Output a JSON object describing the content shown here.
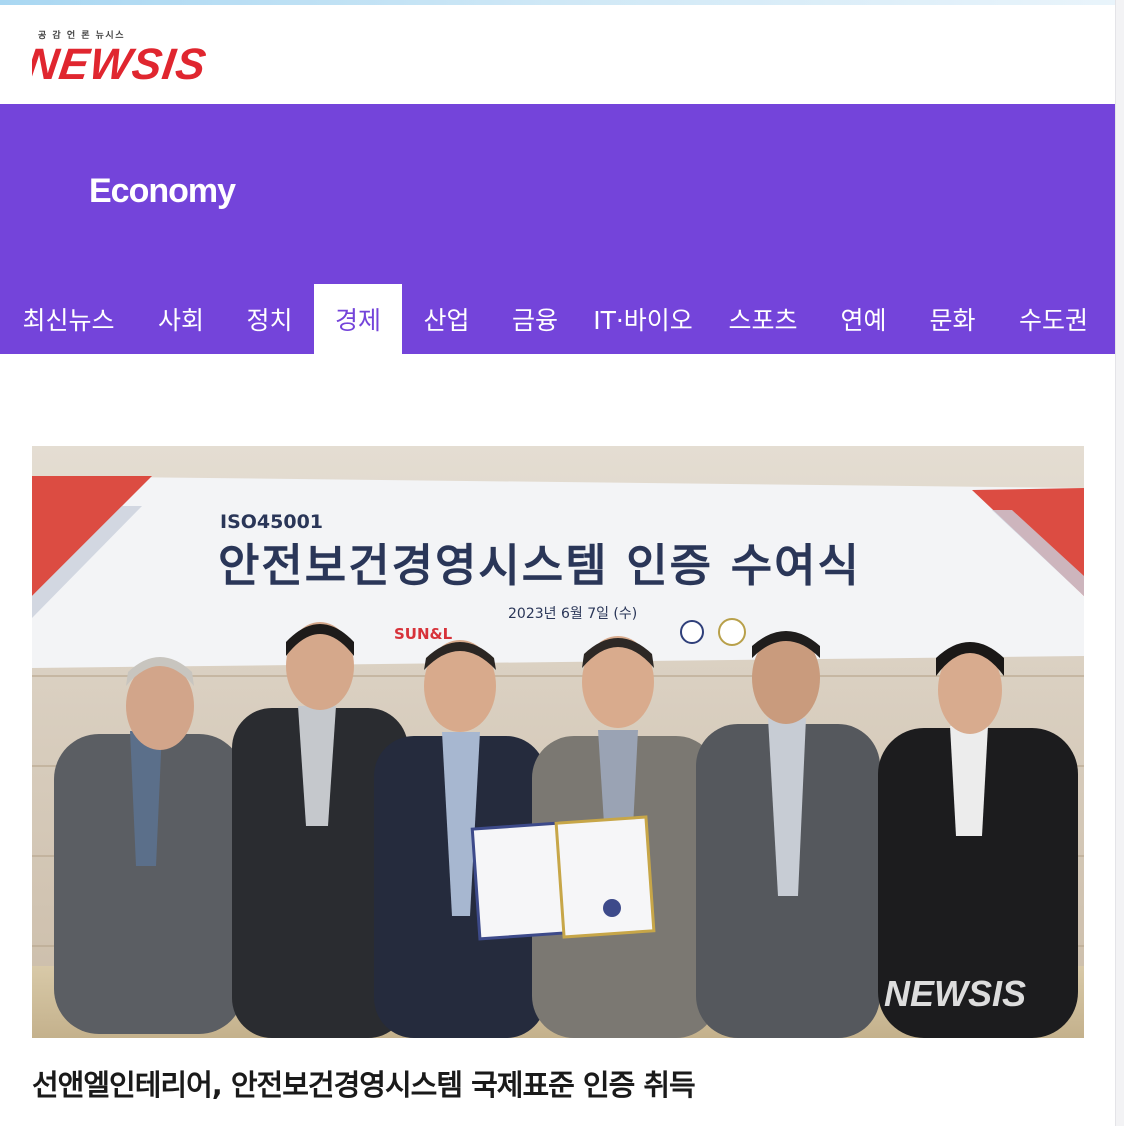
{
  "brand": {
    "logo_text": "NEWSIS",
    "logo_tagline": "공 감 언 론 뉴시스",
    "accent_color": "#7444da",
    "logo_color": "#e0262f"
  },
  "section": {
    "title": "Economy"
  },
  "nav": {
    "items": [
      {
        "label": "최신뉴스",
        "active": false
      },
      {
        "label": "사회",
        "active": false
      },
      {
        "label": "정치",
        "active": false
      },
      {
        "label": "경제",
        "active": true
      },
      {
        "label": "산업",
        "active": false
      },
      {
        "label": "금융",
        "active": false
      },
      {
        "label": "IT·바이오",
        "active": false
      },
      {
        "label": "스포츠",
        "active": false
      },
      {
        "label": "연예",
        "active": false
      },
      {
        "label": "문화",
        "active": false
      },
      {
        "label": "수도권",
        "active": false
      }
    ]
  },
  "article": {
    "photo": {
      "banner_code": "ISO45001",
      "banner_title": "안전보건경영시스템 인증 수여식",
      "banner_date": "2023년 6월 7일 (수)",
      "banner_logo": "SUN&L",
      "watermark": "NEWSIS"
    },
    "headline": "선앤엘인테리어, 안전보건경영시스템 국제표준 인증 취득"
  }
}
